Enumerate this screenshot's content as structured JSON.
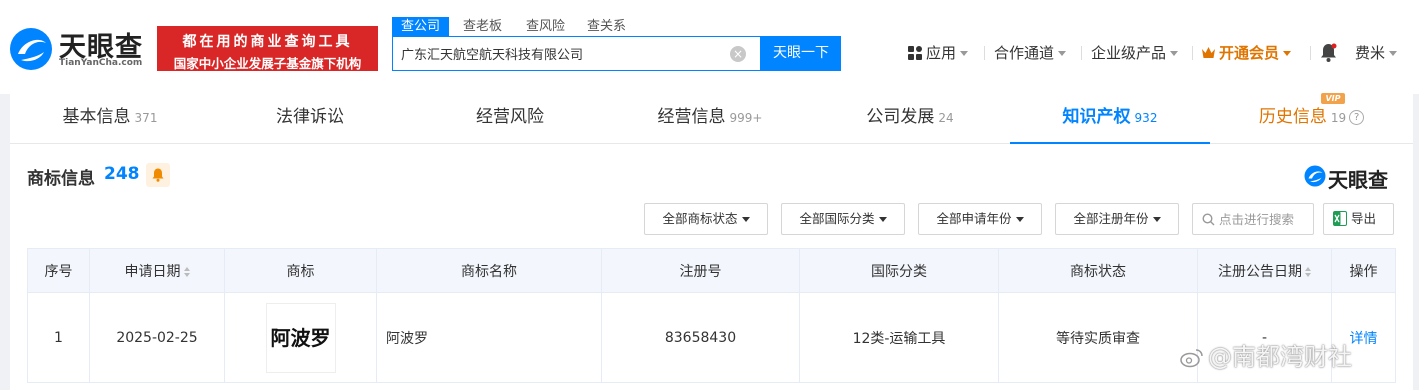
{
  "brand": {
    "name": "天眼查",
    "domain": "TianYanCha.com",
    "slogan_line1": "都在用的商业查询工具",
    "slogan_line2": "国家中小企业发展子基金旗下机构"
  },
  "search": {
    "tabs": [
      "查公司",
      "查老板",
      "查风险",
      "查关系"
    ],
    "active_tab": "查公司",
    "value": "广东汇天航空航天科技有限公司",
    "button": "天眼一下"
  },
  "nav": {
    "app": "应用",
    "cooperation": "合作通道",
    "enterprise": "企业级产品",
    "vip": "开通会员",
    "user": "费米"
  },
  "tabs": [
    {
      "label": "基本信息",
      "count": "371"
    },
    {
      "label": "法律诉讼",
      "count": ""
    },
    {
      "label": "经营风险",
      "count": ""
    },
    {
      "label": "经营信息",
      "count": "999+"
    },
    {
      "label": "公司发展",
      "count": "24"
    },
    {
      "label": "知识产权",
      "count": "932",
      "active": true
    },
    {
      "label": "历史信息",
      "count": "19",
      "vip_badge": "VIP"
    }
  ],
  "section": {
    "title": "商标信息",
    "count": "248",
    "logo_text": "天眼查"
  },
  "filters": {
    "status": "全部商标状态",
    "intl_class": "全部国际分类",
    "apply_year": "全部申请年份",
    "reg_year": "全部注册年份",
    "search_placeholder": "点击进行搜索",
    "export": "导出"
  },
  "table": {
    "headers": [
      "序号",
      "申请日期",
      "商标",
      "商标名称",
      "注册号",
      "国际分类",
      "商标状态",
      "注册公告日期",
      "操作"
    ],
    "rows": [
      {
        "index": "1",
        "apply_date": "2025-02-25",
        "trademark_image_text": "阿波罗",
        "name": "阿波罗",
        "reg_no": "83658430",
        "intl_class": "12类-运输工具",
        "status": "等待实质审查",
        "reg_date": "-",
        "action": "详情"
      }
    ]
  },
  "watermark": "@南都湾财社",
  "colors": {
    "brand_blue": "#0084ff",
    "slogan_red": "#d92727",
    "vip_orange": "#e07400"
  }
}
